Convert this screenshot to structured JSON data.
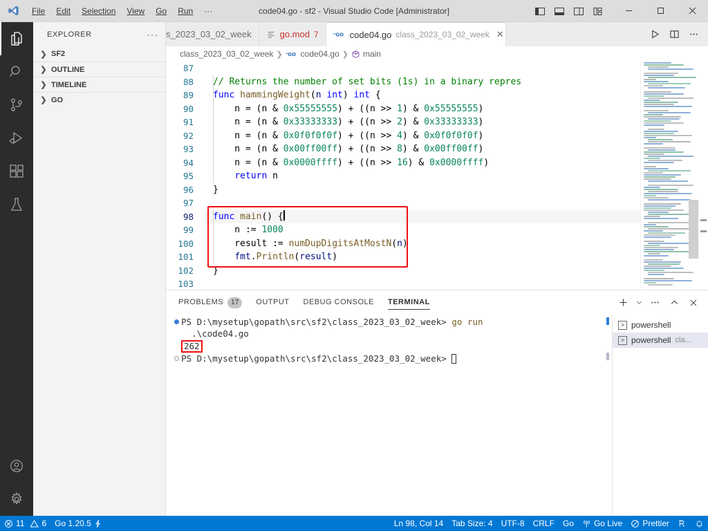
{
  "window": {
    "title": "code04.go - sf2 - Visual Studio Code [Administrator]",
    "menus": [
      "File",
      "Edit",
      "Selection",
      "View",
      "Go",
      "Run",
      "···"
    ],
    "layout_buttons": [
      "toggle-primary-sidebar",
      "toggle-panel",
      "toggle-secondary-sidebar",
      "customize-layout"
    ],
    "controls": {
      "minimize": "─",
      "maximize": "□",
      "close": "✕"
    }
  },
  "activitybar": {
    "items": [
      {
        "name": "explorer",
        "label": "Explorer"
      },
      {
        "name": "search",
        "label": "Search"
      },
      {
        "name": "source-control",
        "label": "Source Control"
      },
      {
        "name": "run-and-debug",
        "label": "Run and Debug"
      },
      {
        "name": "extensions",
        "label": "Extensions"
      },
      {
        "name": "testing",
        "label": "Testing"
      }
    ],
    "bottom": [
      {
        "name": "accounts",
        "label": "Accounts"
      },
      {
        "name": "manage",
        "label": "Manage"
      }
    ]
  },
  "sidebar": {
    "title": "EXPLORER",
    "more_actions": "···",
    "sections": [
      {
        "label": "SF2",
        "expanded": false
      },
      {
        "label": "OUTLINE",
        "expanded": false
      },
      {
        "label": "TIMELINE",
        "expanded": false
      },
      {
        "label": "GO",
        "expanded": false
      }
    ]
  },
  "tabs": [
    {
      "label": "s_2023_03_02_week",
      "description": "",
      "badge": "",
      "active": false,
      "icon": ""
    },
    {
      "label": "go.mod",
      "description": "",
      "badge": "7",
      "active": false,
      "icon": "list-icon"
    },
    {
      "label": "code04.go",
      "description": "class_2023_03_02_week",
      "badge": "",
      "active": true,
      "icon": "go-icon"
    }
  ],
  "tabs_actions": [
    "run-button",
    "split-editor-button",
    "more-actions-button"
  ],
  "breadcrumbs": [
    {
      "label": "class_2023_03_02_week",
      "icon": ""
    },
    {
      "label": "code04.go",
      "icon": "go-icon"
    },
    {
      "label": "main",
      "icon": "symbol-method-icon"
    }
  ],
  "editor": {
    "first_line": 87,
    "lines": [
      {
        "n": 87,
        "tokens": []
      },
      {
        "n": 88,
        "tokens": [
          {
            "t": "cmt",
            "v": "// Returns the number of set bits (1s) in a binary repres"
          }
        ]
      },
      {
        "n": 89,
        "tokens": [
          {
            "t": "kw",
            "v": "func"
          },
          {
            "t": "op",
            "v": " "
          },
          {
            "t": "fn",
            "v": "hammingWeight"
          },
          {
            "t": "punc",
            "v": "("
          },
          {
            "t": "var",
            "v": "n"
          },
          {
            "t": "op",
            "v": " "
          },
          {
            "t": "kw",
            "v": "int"
          },
          {
            "t": "punc",
            "v": ") "
          },
          {
            "t": "kw",
            "v": "int"
          },
          {
            "t": "punc",
            "v": " {"
          }
        ]
      },
      {
        "n": 90,
        "tokens": [
          {
            "t": "op",
            "v": "    n = (n & "
          },
          {
            "t": "num",
            "v": "0x55555555"
          },
          {
            "t": "op",
            "v": ") + ((n >> "
          },
          {
            "t": "num",
            "v": "1"
          },
          {
            "t": "op",
            "v": ") & "
          },
          {
            "t": "num",
            "v": "0x55555555"
          },
          {
            "t": "op",
            "v": ")"
          }
        ]
      },
      {
        "n": 91,
        "tokens": [
          {
            "t": "op",
            "v": "    n = (n & "
          },
          {
            "t": "num",
            "v": "0x33333333"
          },
          {
            "t": "op",
            "v": ") + ((n >> "
          },
          {
            "t": "num",
            "v": "2"
          },
          {
            "t": "op",
            "v": ") & "
          },
          {
            "t": "num",
            "v": "0x33333333"
          },
          {
            "t": "op",
            "v": ")"
          }
        ]
      },
      {
        "n": 92,
        "tokens": [
          {
            "t": "op",
            "v": "    n = (n & "
          },
          {
            "t": "num",
            "v": "0x0f0f0f0f"
          },
          {
            "t": "op",
            "v": ") + ((n >> "
          },
          {
            "t": "num",
            "v": "4"
          },
          {
            "t": "op",
            "v": ") & "
          },
          {
            "t": "num",
            "v": "0x0f0f0f0f"
          },
          {
            "t": "op",
            "v": ")"
          }
        ]
      },
      {
        "n": 93,
        "tokens": [
          {
            "t": "op",
            "v": "    n = (n & "
          },
          {
            "t": "num",
            "v": "0x00ff00ff"
          },
          {
            "t": "op",
            "v": ") + ((n >> "
          },
          {
            "t": "num",
            "v": "8"
          },
          {
            "t": "op",
            "v": ") & "
          },
          {
            "t": "num",
            "v": "0x00ff00ff"
          },
          {
            "t": "op",
            "v": ")"
          }
        ]
      },
      {
        "n": 94,
        "tokens": [
          {
            "t": "op",
            "v": "    n = (n & "
          },
          {
            "t": "num",
            "v": "0x0000ffff"
          },
          {
            "t": "op",
            "v": ") + ((n >> "
          },
          {
            "t": "num",
            "v": "16"
          },
          {
            "t": "op",
            "v": ") & "
          },
          {
            "t": "num",
            "v": "0x0000ffff"
          },
          {
            "t": "op",
            "v": ")"
          }
        ]
      },
      {
        "n": 95,
        "tokens": [
          {
            "t": "op",
            "v": "    "
          },
          {
            "t": "kw",
            "v": "return"
          },
          {
            "t": "op",
            "v": " n"
          }
        ]
      },
      {
        "n": 96,
        "tokens": [
          {
            "t": "punc",
            "v": "}"
          }
        ]
      },
      {
        "n": 97,
        "tokens": []
      },
      {
        "n": 98,
        "tokens": [
          {
            "t": "kw",
            "v": "func"
          },
          {
            "t": "op",
            "v": " "
          },
          {
            "t": "fn",
            "v": "main"
          },
          {
            "t": "punc",
            "v": "() {"
          }
        ]
      },
      {
        "n": 99,
        "tokens": [
          {
            "t": "op",
            "v": "    n := "
          },
          {
            "t": "num",
            "v": "1000"
          }
        ]
      },
      {
        "n": 100,
        "tokens": [
          {
            "t": "op",
            "v": "    result := "
          },
          {
            "t": "fn",
            "v": "numDupDigitsAtMostN"
          },
          {
            "t": "punc",
            "v": "("
          },
          {
            "t": "var",
            "v": "n"
          },
          {
            "t": "punc",
            "v": ")"
          }
        ]
      },
      {
        "n": 101,
        "tokens": [
          {
            "t": "op",
            "v": "    "
          },
          {
            "t": "var",
            "v": "fmt"
          },
          {
            "t": "punc",
            "v": "."
          },
          {
            "t": "fn",
            "v": "Println"
          },
          {
            "t": "punc",
            "v": "("
          },
          {
            "t": "var",
            "v": "result"
          },
          {
            "t": "punc",
            "v": ")"
          }
        ]
      },
      {
        "n": 102,
        "tokens": [
          {
            "t": "punc",
            "v": "}"
          }
        ]
      },
      {
        "n": 103,
        "tokens": []
      }
    ],
    "cursor_line": 98,
    "highlight_color": "#ee1111"
  },
  "panel": {
    "tabs": [
      {
        "label": "PROBLEMS",
        "badge": "17",
        "active": false
      },
      {
        "label": "OUTPUT",
        "badge": "",
        "active": false
      },
      {
        "label": "DEBUG CONSOLE",
        "badge": "",
        "active": false
      },
      {
        "label": "TERMINAL",
        "badge": "",
        "active": true
      }
    ],
    "actions": [
      "new-terminal-button",
      "terminal-dropdown-button",
      "more-actions-button",
      "maximize-panel-button",
      "close-panel-button"
    ],
    "terminal": {
      "lines": [
        {
          "marker": "filled",
          "prompt": "PS D:\\mysetup\\gopath\\src\\sf2\\class_2023_03_02_week>",
          "command": " go run"
        },
        {
          "marker": "none",
          "prompt": "",
          "command": "  .\\code04.go"
        },
        {
          "marker": "none",
          "output": "262",
          "boxed": true
        },
        {
          "marker": "hollow",
          "prompt": "PS D:\\mysetup\\gopath\\src\\sf2\\class_2023_03_02_week>",
          "command": "",
          "cursor": true
        }
      ],
      "instances": [
        {
          "label": "powershell",
          "sub": "",
          "selected": false
        },
        {
          "label": "powershell",
          "sub": "cla...",
          "selected": true
        }
      ]
    }
  },
  "statusbar": {
    "left": [
      {
        "name": "problems",
        "icon": "error-icon",
        "text": "11"
      },
      {
        "name": "warnings",
        "icon": "warning-icon",
        "text": "6"
      },
      {
        "name": "go-version",
        "icon": "",
        "text": "Go 1.20.5"
      },
      {
        "name": "go-lightning",
        "icon": "lightning-icon",
        "text": ""
      }
    ],
    "right": [
      {
        "name": "editor-position",
        "text": "Ln 98, Col 14"
      },
      {
        "name": "editor-indentation",
        "text": "Tab Size: 4"
      },
      {
        "name": "editor-encoding",
        "text": "UTF-8"
      },
      {
        "name": "editor-eol",
        "text": "CRLF"
      },
      {
        "name": "editor-language",
        "text": "Go"
      },
      {
        "name": "go-live",
        "icon": "broadcast-icon",
        "text": "Go Live"
      },
      {
        "name": "prettier",
        "icon": "prettier-icon",
        "text": "Prettier"
      },
      {
        "name": "screencast",
        "icon": "screencast-icon",
        "text": ""
      },
      {
        "name": "notifications",
        "icon": "bell-icon",
        "text": ""
      }
    ],
    "background": "#0078d4"
  }
}
